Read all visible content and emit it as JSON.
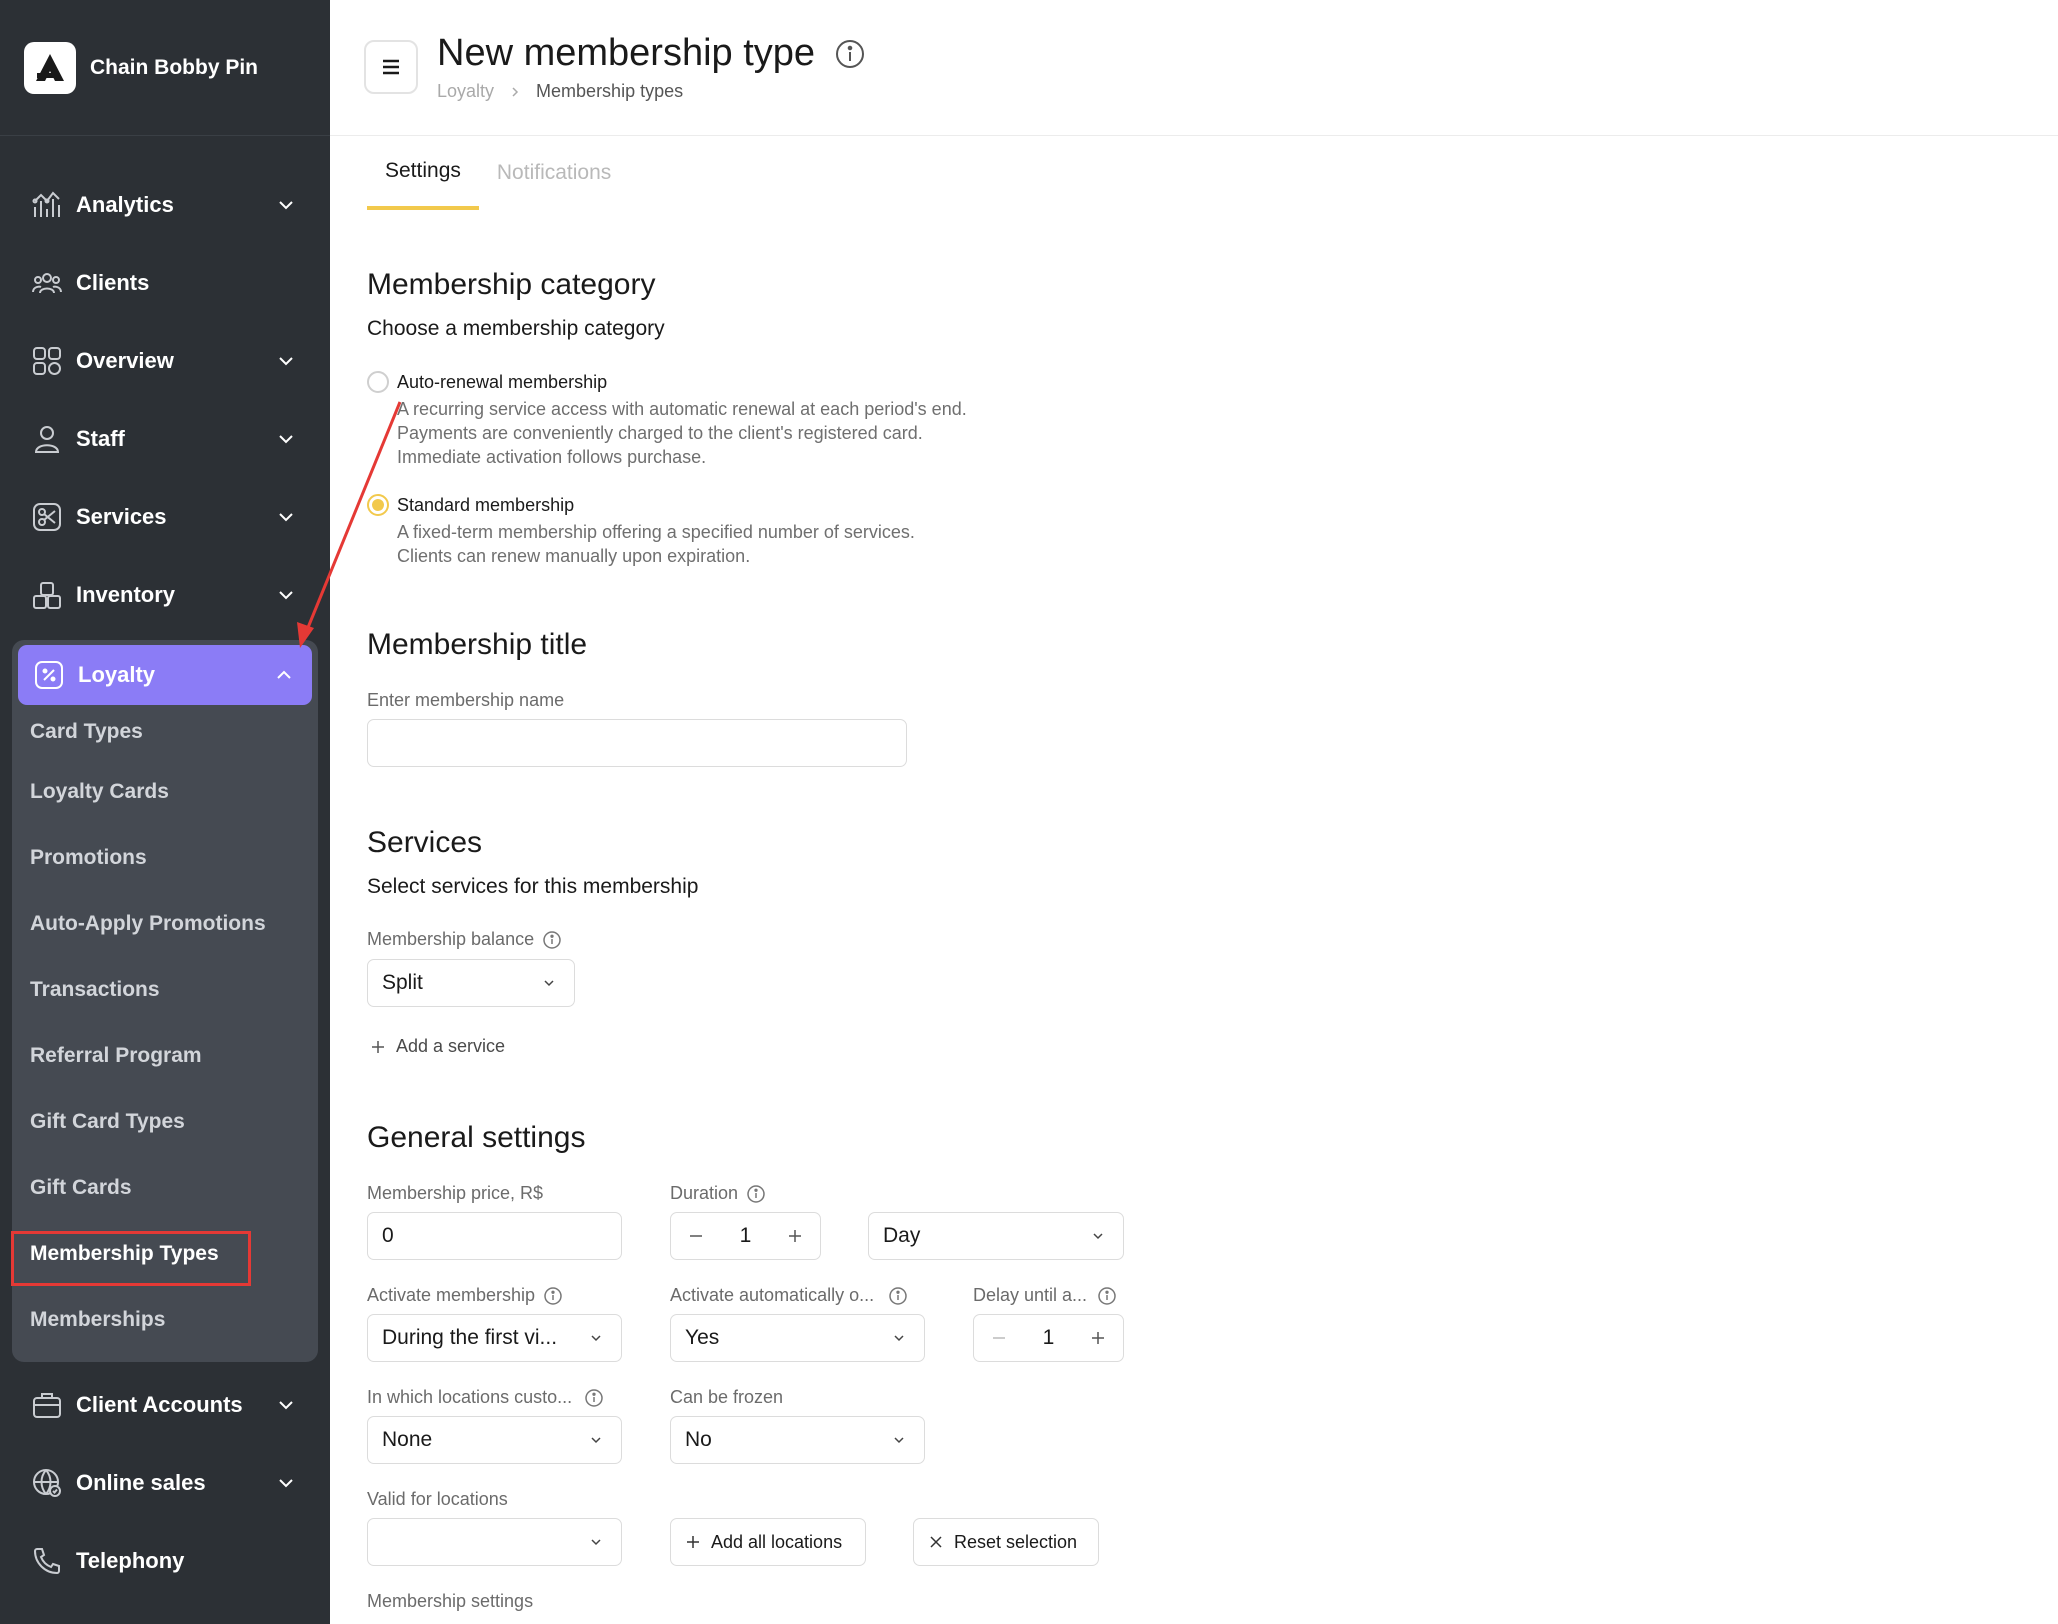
{
  "sidebar": {
    "brand": "Chain Bobby Pin",
    "items": [
      {
        "label": "Analytics",
        "icon": "analytics-icon"
      },
      {
        "label": "Clients",
        "icon": "clients-icon"
      },
      {
        "label": "Overview",
        "icon": "overview-icon"
      },
      {
        "label": "Staff",
        "icon": "staff-icon"
      },
      {
        "label": "Services",
        "icon": "services-icon"
      },
      {
        "label": "Inventory",
        "icon": "inventory-icon"
      }
    ],
    "loyalty": {
      "label": "Loyalty",
      "sub_items": [
        "Card Types",
        "Loyalty Cards",
        "Promotions",
        "Auto-Apply Promotions",
        "Transactions",
        "Referral Program",
        "Gift Card Types",
        "Gift Cards",
        "Membership Types",
        "Memberships"
      ],
      "active_sub_item": "Membership Types"
    },
    "bottom_items": [
      {
        "label": "Client Accounts",
        "icon": "client-accounts-icon"
      },
      {
        "label": "Online sales",
        "icon": "online-sales-icon"
      },
      {
        "label": "Telephony",
        "icon": "telephony-icon"
      }
    ],
    "accent_color": "#8b7cf6",
    "background_color": "#2c3035"
  },
  "header": {
    "title": "New membership type",
    "breadcrumb": [
      "Loyalty",
      "Membership types"
    ]
  },
  "tabs": [
    {
      "label": "Settings",
      "active": true
    },
    {
      "label": "Notifications",
      "active": false
    }
  ],
  "category": {
    "title": "Membership category",
    "subtitle": "Choose a membership category",
    "options": [
      {
        "title": "Auto-renewal membership",
        "desc": [
          "A recurring service access with automatic renewal at each period's end.",
          "Payments are conveniently charged to the client's registered card.",
          "Immediate activation follows purchase."
        ],
        "checked": false
      },
      {
        "title": "Standard membership",
        "desc": [
          "A fixed-term membership offering a specified number of services.",
          "Clients can renew manually upon expiration."
        ],
        "checked": true
      }
    ]
  },
  "membership_title": {
    "title": "Membership title",
    "label": "Enter membership name",
    "value": ""
  },
  "services": {
    "title": "Services",
    "subtitle": "Select services for this membership",
    "balance_label": "Membership balance",
    "balance_value": "Split",
    "add_service": "Add a service"
  },
  "general": {
    "title": "General settings",
    "price_label": "Membership price, R$",
    "price_value": "0",
    "duration_label": "Duration",
    "duration_value": "1",
    "duration_unit": "Day",
    "activate_label": "Activate membership",
    "activate_value": "During the first vi...",
    "auto_activate_label": "Activate automatically o...",
    "auto_activate_value": "Yes",
    "delay_label": "Delay until a...",
    "delay_value": "1",
    "locations_custom_label": "In which locations custo...",
    "locations_custom_value": "None",
    "frozen_label": "Can be frozen",
    "frozen_value": "No",
    "valid_locations_label": "Valid for locations",
    "valid_locations_value": "",
    "add_all_locations": "Add all locations",
    "reset_selection": "Reset selection",
    "membership_settings_label": "Membership settings"
  },
  "colors": {
    "tab_underline": "#f2c94c",
    "radio_checked": "#f2c94c",
    "annotation": "#e53935"
  }
}
